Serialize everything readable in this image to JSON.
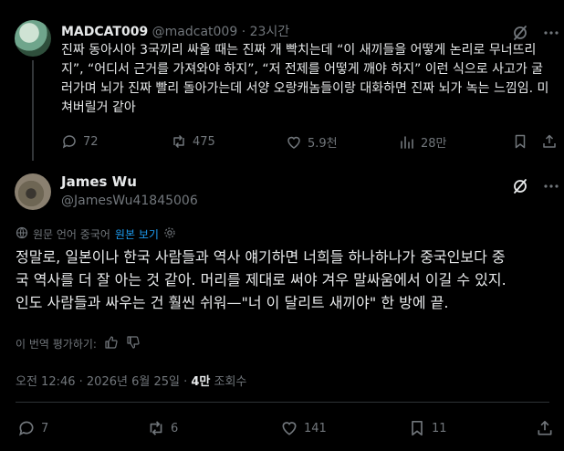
{
  "reply": {
    "display_name": "MADCAT009",
    "handle": "@madcat009",
    "time": "· 23시간",
    "text": "진짜 동아시아 3국끼리 싸울 때는 진짜 개 빡치는데 “이 새끼들을 어떻게 논리로 무너뜨리지”, “어디서 근거를 가져와야 하지”, “저 전제를 어떻게 깨야 하지” 이런 식으로 사고가 굴러가며 뇌가 진짜 빨리 돌아가는데 서양 오랑캐놈들이랑 대화하면 진짜 뇌가 녹는 느낌임. 미쳐버릴거 같아",
    "actions": {
      "replies": "72",
      "reposts": "475",
      "likes": "5.9천",
      "views": "28만"
    }
  },
  "post": {
    "display_name": "James Wu",
    "handle": "@JamesWu41845006",
    "translated_notice": "원문 언어 중국어",
    "show_original": "원본 보기",
    "text_lines": [
      "정말로, 일본이나 한국 사람들과 역사 얘기하면 너희들 하나하나가 중국인보다 중",
      "국 역사를 더 잘 아는 것 같아. 머리를 제대로 써야 겨우 말싸움에서 이길 수 있지.",
      "인도 사람들과 싸우는 건 훨씬 쉬워—\"너 이 달리트 새끼야\" 한 방에 끝."
    ],
    "rate_translation": "이 번역 평가하기:",
    "timestamp": "오전 12:46 · 2026년 6월 25일 · ",
    "views_count": "4만",
    "views_label": " 조회수",
    "actions": {
      "replies": "7",
      "reposts": "6",
      "likes": "141",
      "bookmarks": "11"
    }
  },
  "colors": {
    "background": "#000000",
    "text": "#e7e9ea",
    "muted": "#71767b",
    "accent": "#1d9bf0",
    "divider": "#2f3336"
  }
}
